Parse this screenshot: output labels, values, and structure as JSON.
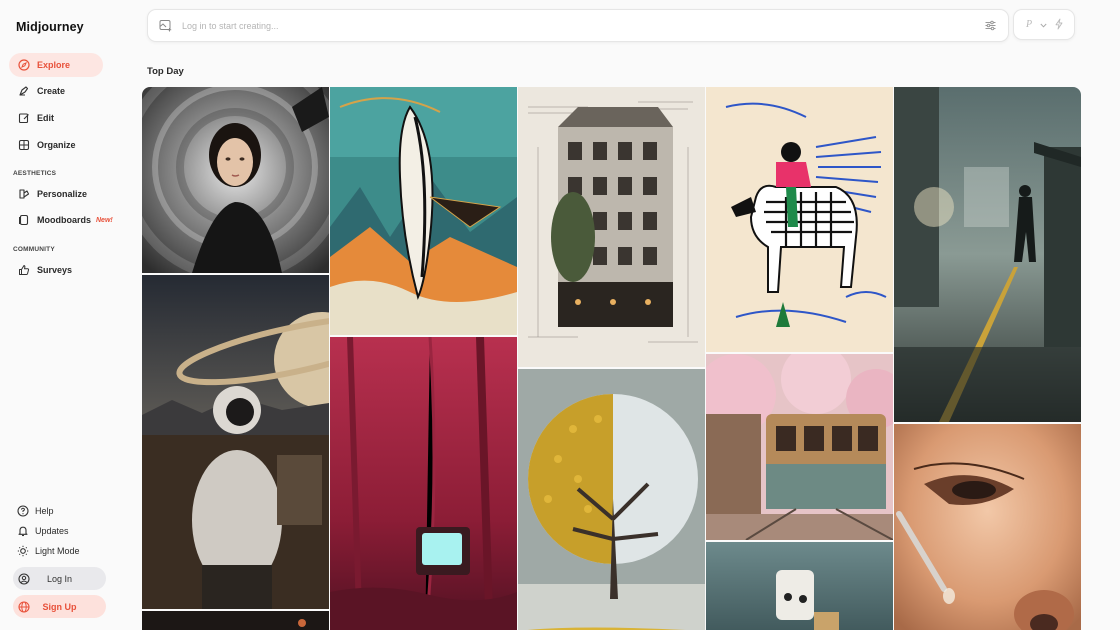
{
  "app": {
    "name": "Midjourney"
  },
  "nav": {
    "explore": "Explore",
    "create": "Create",
    "edit": "Edit",
    "organize": "Organize",
    "aesthetics_label": "AESTHETICS",
    "personalize": "Personalize",
    "moodboards": "Moodboards",
    "moodboards_badge": "New!",
    "community_label": "COMMUNITY",
    "surveys": "Surveys"
  },
  "bottom": {
    "help": "Help",
    "updates": "Updates",
    "light_mode": "Light Mode",
    "login": "Log In",
    "signup": "Sign Up"
  },
  "search": {
    "placeholder": "Log in to start creating..."
  },
  "mode": {
    "letter": "P"
  },
  "section": {
    "title": "Top Day"
  },
  "gallery": [
    {
      "name": "gallery-image-woman-swirl-portrait",
      "subject": "woman swirl portrait"
    },
    {
      "name": "gallery-image-astronaut-saturn",
      "subject": "astronaut saturn"
    },
    {
      "name": "gallery-image-whale-ukiyoe",
      "subject": "whale ukiyo-e"
    },
    {
      "name": "gallery-image-red-forest-tv",
      "subject": "red forest tv"
    },
    {
      "name": "gallery-image-architecture-sketch",
      "subject": "architecture sketch"
    },
    {
      "name": "gallery-image-yellow-white-tree",
      "subject": "yellow white tree"
    },
    {
      "name": "gallery-image-zebra-rider",
      "subject": "zebra rider"
    },
    {
      "name": "gallery-image-tram-cherry-blossom",
      "subject": "tram cherry blossom"
    },
    {
      "name": "gallery-image-robot-figure",
      "subject": "robot figure"
    },
    {
      "name": "gallery-image-foggy-street",
      "subject": "foggy street"
    },
    {
      "name": "gallery-image-skin-dropper-closeup",
      "subject": "skin dropper closeup"
    }
  ],
  "colors": {
    "accent": "#e8513a",
    "active_bg": "#fde6e2"
  }
}
